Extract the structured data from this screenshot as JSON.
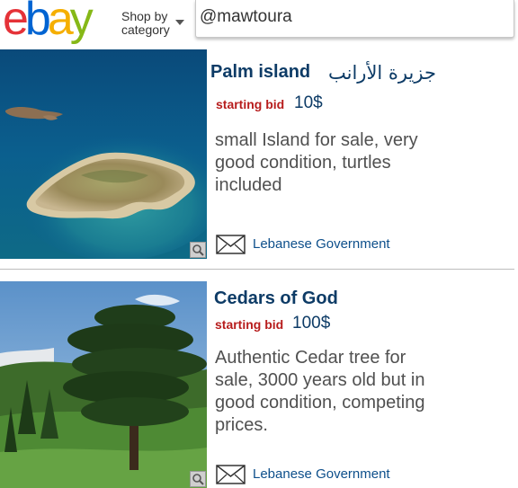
{
  "header": {
    "logo_text": {
      "e": "e",
      "b": "b",
      "a": "a",
      "y": "y"
    },
    "logo_colors": {
      "e": "#e53238",
      "b": "#0064d2",
      "a": "#f5af02",
      "y": "#86b817"
    },
    "shop_line1": "Shop by",
    "shop_line2": "category",
    "search_value": "@mawtoura"
  },
  "listings": [
    {
      "title": "Palm island",
      "title_arabic": "جزيرة الأرانب",
      "bid_label": "starting bid",
      "bid_value": "10$",
      "description_lines": [
        "small Island for sale, very",
        "good condition, turtles",
        "included"
      ],
      "seller": "Lebanese Government",
      "image": "island-photo"
    },
    {
      "title": "Cedars of God",
      "bid_label": "starting bid",
      "bid_value": "100$",
      "description_lines": [
        "Authentic Cedar tree for",
        "sale, 3000 years old but in",
        "good condition, competing",
        "prices."
      ],
      "seller": "Lebanese Government",
      "image": "cedar-tree-photo"
    }
  ],
  "icons": {
    "envelope": "envelope-icon",
    "zoom": "zoom-icon",
    "caret": "chevron-down-icon"
  }
}
